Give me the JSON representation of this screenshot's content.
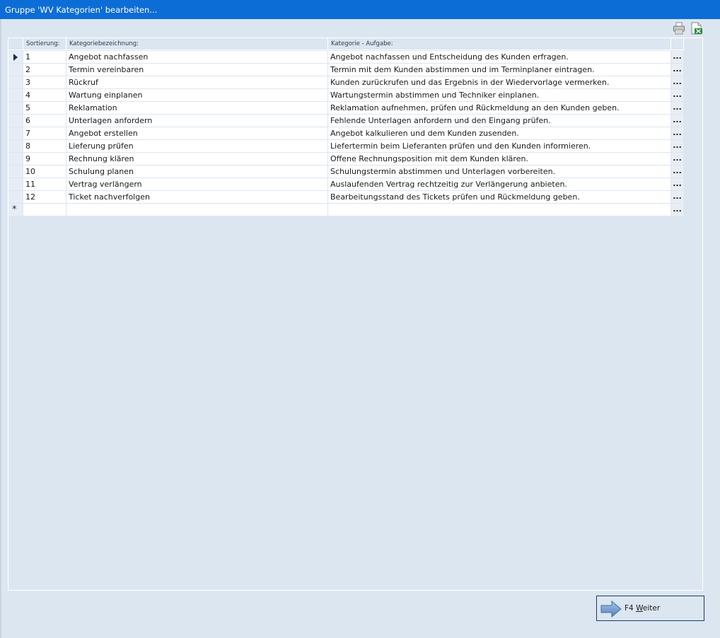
{
  "window": {
    "title": "Gruppe 'WV Kategorien' bearbeiten..."
  },
  "toolbar": {
    "print_icon": "printer-icon",
    "export_icon": "excel-export-icon"
  },
  "grid": {
    "headers": {
      "sort": "Sortierung:",
      "name": "Kategoriebezeichnung:",
      "task": "Kategorie - Aufgabe:"
    },
    "ellipsis": "...",
    "new_row_marker": "*",
    "rows": [
      {
        "sort": "1",
        "name": "Angebot nachfassen",
        "task": "Angebot nachfassen und Entscheidung des Kunden erfragen."
      },
      {
        "sort": "2",
        "name": "Termin vereinbaren",
        "task": "Termin mit dem Kunden abstimmen und im Terminplaner eintragen."
      },
      {
        "sort": "3",
        "name": "Rückruf",
        "task": "Kunden zurückrufen und das Ergebnis in der Wiedervorlage vermerken."
      },
      {
        "sort": "4",
        "name": "Wartung einplanen",
        "task": "Wartungstermin abstimmen und Techniker einplanen."
      },
      {
        "sort": "5",
        "name": "Reklamation",
        "task": "Reklamation aufnehmen, prüfen und Rückmeldung an den Kunden geben."
      },
      {
        "sort": "6",
        "name": "Unterlagen anfordern",
        "task": "Fehlende Unterlagen anfordern und den Eingang prüfen."
      },
      {
        "sort": "7",
        "name": "Angebot erstellen",
        "task": "Angebot kalkulieren und dem Kunden zusenden."
      },
      {
        "sort": "8",
        "name": "Lieferung prüfen",
        "task": "Liefertermin beim Lieferanten prüfen und den Kunden informieren."
      },
      {
        "sort": "9",
        "name": "Rechnung klären",
        "task": "Offene Rechnungsposition mit dem Kunden klären."
      },
      {
        "sort": "10",
        "name": "Schulung planen",
        "task": "Schulungstermin abstimmen und Unterlagen vorbereiten."
      },
      {
        "sort": "11",
        "name": "Vertrag verlängern",
        "task": "Auslaufenden Vertrag rechtzeitig zur Verlängerung anbieten."
      },
      {
        "sort": "12",
        "name": "Ticket nachverfolgen",
        "task": "Bearbeitungsstand des Tickets prüfen und Rückmeldung geben."
      }
    ]
  },
  "footer": {
    "next_key": "F4",
    "next_label_underlined": "W",
    "next_label_rest": "eiter",
    "next_icon": "arrow-right-icon"
  }
}
